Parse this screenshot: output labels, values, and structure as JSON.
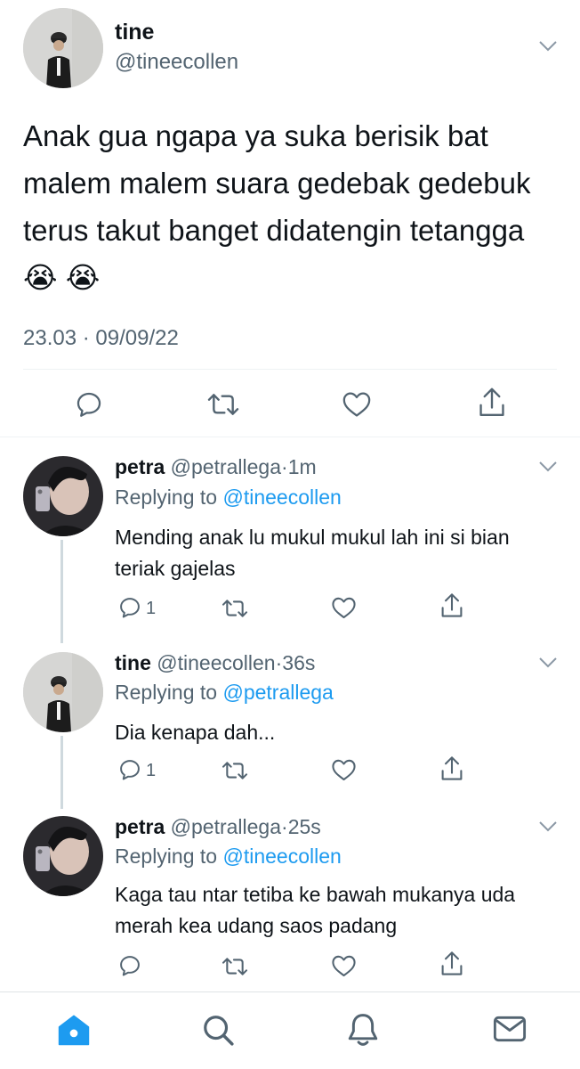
{
  "main_tweet": {
    "author_name": "tine",
    "author_handle": "@tineecollen",
    "text": "Anak gua ngapa ya suka berisik bat malem malem suara gedebak gedebuk terus takut banget didatengin tetangga 😭 😭",
    "time": "23.03",
    "separator": "·",
    "date": "09/09/22"
  },
  "replies": [
    {
      "name": "petra",
      "handle": "@petrallega",
      "sep": "·",
      "time": "1m",
      "replying_prefix": "Replying to",
      "replying_to": "@tineecollen",
      "text": "Mending anak lu mukul mukul lah ini si bian teriak gajelas",
      "reply_count": "1"
    },
    {
      "name": "tine",
      "handle": "@tineecollen",
      "sep": "·",
      "time": "36s",
      "replying_prefix": "Replying to",
      "replying_to": "@petrallega",
      "text": "Dia kenapa dah...",
      "reply_count": "1"
    },
    {
      "name": "petra",
      "handle": "@petrallega",
      "sep": "·",
      "time": "25s",
      "replying_prefix": "Replying to",
      "replying_to": "@tineecollen",
      "text": "Kaga tau ntar tetiba ke bawah mukanya uda merah kea udang saos padang",
      "reply_count": ""
    }
  ],
  "tab_bar": {
    "items": [
      "home-icon",
      "search-icon",
      "notifications-icon",
      "messages-icon"
    ],
    "active_color": "#1d9bf0"
  },
  "colors": {
    "accent": "#1d9bf0",
    "secondary_text": "#536471",
    "primary_text": "#0f1419"
  }
}
